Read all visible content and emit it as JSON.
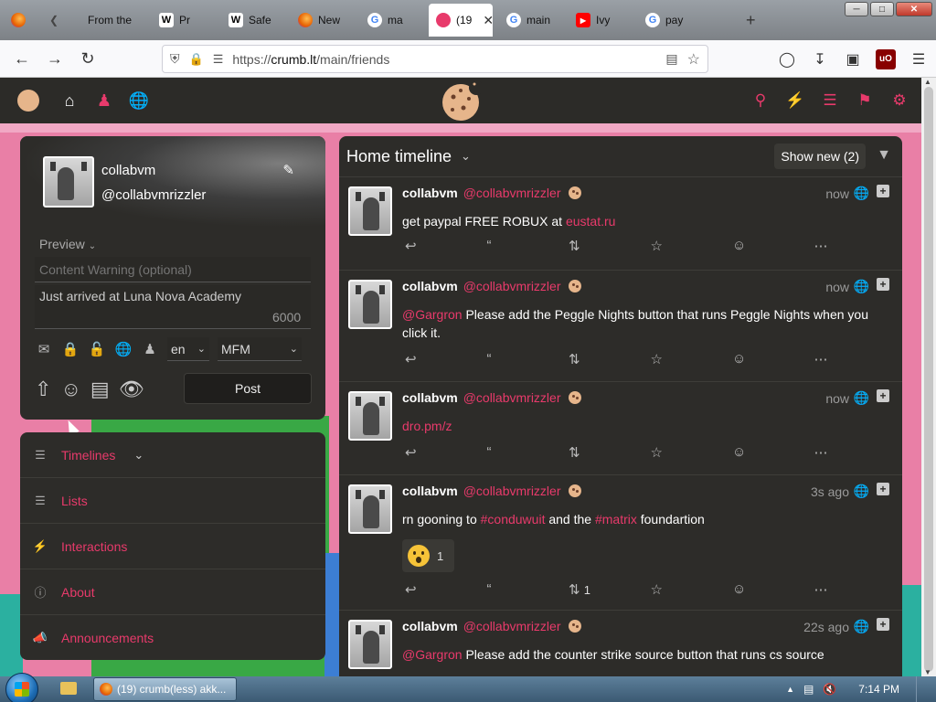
{
  "browser": {
    "tabs": [
      {
        "label": "",
        "icon": "firefox-icon"
      },
      {
        "label": "",
        "icon": "back-icon"
      },
      {
        "label": "From the",
        "icon": "image-icon"
      },
      {
        "label": "Pr",
        "icon": "wikipedia-icon"
      },
      {
        "label": "Safe",
        "icon": "wikipedia-icon"
      },
      {
        "label": "New",
        "icon": "firefox-icon"
      },
      {
        "label": "ma",
        "icon": "google-icon"
      },
      {
        "label": "(19",
        "icon": "crumb-icon",
        "active": true
      },
      {
        "label": "main",
        "icon": "google-icon"
      },
      {
        "label": "Ivy",
        "icon": "youtube-icon"
      },
      {
        "label": "pay",
        "icon": "google-icon"
      }
    ],
    "url_prefix": "https://",
    "url_host": "crumb.lt",
    "url_path": "/main/friends"
  },
  "compose": {
    "name": "collabvm",
    "handle": "@collabvmrizzler",
    "preview_label": "Preview",
    "cw_placeholder": "Content Warning (optional)",
    "body_text": "Just arrived at Luna Nova Academy",
    "char_count": "6000",
    "language": "en",
    "format": "MFM",
    "post_label": "Post"
  },
  "sidenav": {
    "items": [
      {
        "label": "Timelines",
        "icon": "menu-icon"
      },
      {
        "label": "Lists",
        "icon": "list-icon"
      },
      {
        "label": "Interactions",
        "icon": "bolt-icon"
      },
      {
        "label": "About",
        "icon": "info-icon"
      },
      {
        "label": "Announcements",
        "icon": "megaphone-icon"
      }
    ]
  },
  "timeline": {
    "title": "Home timeline",
    "show_new": "Show new (2)",
    "posts": [
      {
        "name": "collabvm",
        "handle": "@collabvmrizzler",
        "time": "now",
        "text": "get paypal FREE ROBUX at ",
        "link": "eustat.ru"
      },
      {
        "name": "collabvm",
        "handle": "@collabvmrizzler",
        "time": "now",
        "mention": "@Gargron",
        "text": " Please add the Peggle Nights button that runs Peggle Nights when you click it."
      },
      {
        "name": "collabvm",
        "handle": "@collabvmrizzler",
        "time": "now",
        "link": "dro.pm/z"
      },
      {
        "name": "collabvm",
        "handle": "@collabvmrizzler",
        "time": "3s ago",
        "text_a": "rn gooning to ",
        "tag1": "#conduwuit",
        "text_b": " and the ",
        "tag2": "#matrix",
        "text_c": " foundartion",
        "reaction_count": "1",
        "boost_count": "1"
      },
      {
        "name": "collabvm",
        "handle": "@collabvmrizzler",
        "time": "22s ago",
        "mention": "@Gargron",
        "text": " Please add the counter strike source button that runs cs source"
      }
    ]
  },
  "taskbar": {
    "task_label": "(19) crumb(less) akk...",
    "clock": "7:14 PM"
  },
  "colors": {
    "accent": "#e83a6b",
    "panel": "#2d2c29",
    "background_pink": "#e97fa6"
  }
}
